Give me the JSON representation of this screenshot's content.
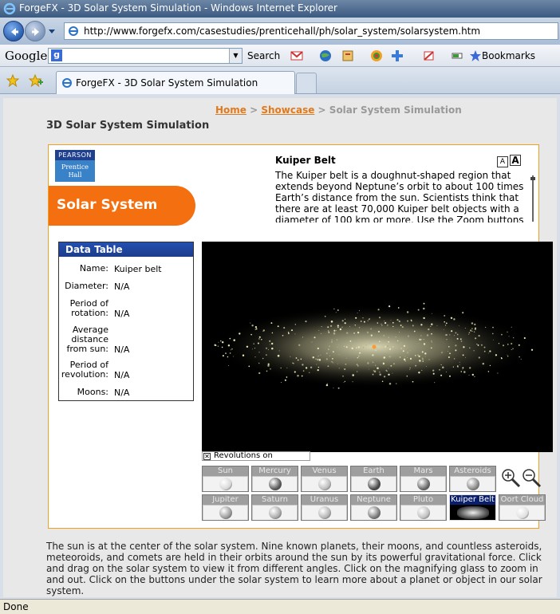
{
  "window": {
    "title": "ForgeFX - 3D Solar System Simulation - Windows Internet Explorer"
  },
  "address": {
    "url": "http://www.forgefx.com/casestudies/prenticehall/ph/solar_system/solarsystem.htm"
  },
  "google_toolbar": {
    "logo": "Google",
    "search_label": "Search",
    "bookmarks_label": "Bookmarks"
  },
  "tab": {
    "label": "ForgeFX - 3D Solar System Simulation"
  },
  "breadcrumb": {
    "home": "Home",
    "sep1": " > ",
    "showcase": "Showcase",
    "sep2": " > ",
    "current": "Solar System Simulation"
  },
  "page": {
    "title": "3D Solar System Simulation"
  },
  "brand": {
    "line1": "PEARSON",
    "line2": "Prentice",
    "line3": "Hall",
    "banner": "Solar System"
  },
  "info": {
    "title": "Kuiper Belt",
    "text": "The Kuiper belt is a doughnut-shaped region that extends beyond Neptune’s orbit to about 100 times Earth’s distance from the sun. Scientists think that there are at least 70,000 Kuiper belt objects with a diameter of 100 km or more. Use the Zoom buttons to see the",
    "font_small": "A",
    "font_large": "A"
  },
  "data_table": {
    "header": "Data Table",
    "rows": [
      {
        "label": "Name:",
        "value": "Kuiper belt"
      },
      {
        "label": "Diameter:",
        "value": "N/A"
      },
      {
        "label": "Period of rotation:",
        "value": "N/A"
      },
      {
        "label": "Average distance from sun:",
        "value": "N/A"
      },
      {
        "label": "Period of revolution:",
        "value": "N/A"
      },
      {
        "label": "Moons:",
        "value": "N/A"
      }
    ]
  },
  "revolutions": {
    "label": "Revolutions on",
    "checked": true
  },
  "planets": [
    {
      "label": "Sun",
      "color": "#d8d8d8"
    },
    {
      "label": "Mercury",
      "color": "#5a5a5a"
    },
    {
      "label": "Venus",
      "color": "#bcbcbc"
    },
    {
      "label": "Earth",
      "color": "#4a4a4a"
    },
    {
      "label": "Mars",
      "color": "#6a6a6a"
    },
    {
      "label": "Asteroids",
      "color": "#8a8a8a"
    },
    {
      "label": "Jupiter",
      "color": "#9a9a9a"
    },
    {
      "label": "Saturn",
      "color": "#aaaaaa"
    },
    {
      "label": "Uranus",
      "color": "#b4b4b4"
    },
    {
      "label": "Neptune",
      "color": "#7a7a7a"
    },
    {
      "label": "Pluto",
      "color": "#c0c0c0"
    },
    {
      "label": "Kuiper Belt",
      "color": "#dddddd",
      "selected": true
    },
    {
      "label": "Oort Cloud",
      "color": "#e0e0e0"
    }
  ],
  "description": "The sun is at the center of the solar system. Nine known planets, their moons, and countless asteroids, meteoroids, and comets are held in their orbits around the sun by its powerful gravitational force. Click and drag on the solar system to view it from different angles. Click on the magnifying glass to zoom in and out. Click on the buttons under the solar system to learn more about a planet or object in our solar system.",
  "status": {
    "text": "Done"
  }
}
